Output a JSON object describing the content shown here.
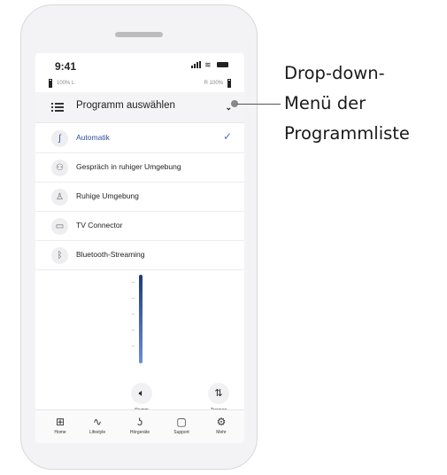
{
  "status_bar": {
    "time": "9:41"
  },
  "devices": {
    "left": {
      "percent": "100%",
      "side": "L"
    },
    "right": {
      "percent": "100%",
      "side": "R"
    }
  },
  "dropdown": {
    "title": "Programm auswählen",
    "items": [
      {
        "label": "Automatik",
        "icon": "auto-icon",
        "selected": true
      },
      {
        "label": "Gespräch in ruhiger Umgebung",
        "icon": "conversation-icon",
        "selected": false
      },
      {
        "label": "Ruhige Umgebung",
        "icon": "quiet-icon",
        "selected": false
      },
      {
        "label": "TV Connector",
        "icon": "tv-icon",
        "selected": false
      },
      {
        "label": "Bluetooth-Streaming",
        "icon": "bluetooth-icon",
        "selected": false
      }
    ]
  },
  "controls": {
    "mute_label": "Stumm",
    "separate_label": "Trennen"
  },
  "tabs": [
    {
      "label": "Home",
      "icon": "home-grid-icon"
    },
    {
      "label": "Lifestyle",
      "icon": "activity-icon"
    },
    {
      "label": "Hörgeräte",
      "icon": "hearing-aid-icon"
    },
    {
      "label": "Support",
      "icon": "chat-icon"
    },
    {
      "label": "Mehr",
      "icon": "gear-icon"
    }
  ],
  "annotation": {
    "lines": [
      "Drop-down-",
      "Menü der",
      "Programmliste"
    ]
  },
  "colors": {
    "accent": "#2e4f9a",
    "check": "#4a6fd1"
  }
}
